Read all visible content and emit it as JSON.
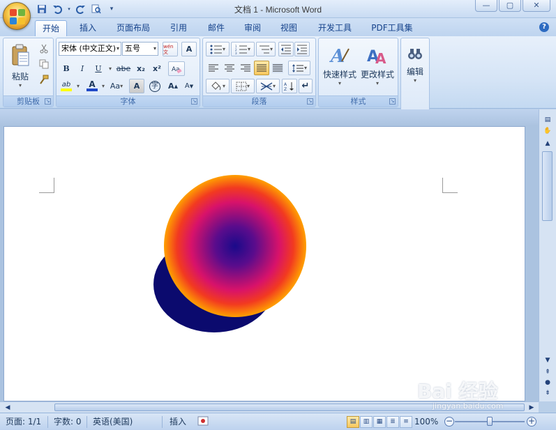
{
  "window": {
    "title": "文档 1 - Microsoft Word"
  },
  "quick_access": [
    "save-icon",
    "undo-icon",
    "redo-icon",
    "print-preview-icon",
    "customize-icon"
  ],
  "tabs": [
    {
      "label": "开始",
      "active": true
    },
    {
      "label": "插入"
    },
    {
      "label": "页面布局"
    },
    {
      "label": "引用"
    },
    {
      "label": "邮件"
    },
    {
      "label": "审阅"
    },
    {
      "label": "视图"
    },
    {
      "label": "开发工具"
    },
    {
      "label": "PDF工具集"
    }
  ],
  "ribbon": {
    "clipboard": {
      "label": "剪贴板",
      "paste_label": "粘贴"
    },
    "font": {
      "label": "字体",
      "font_name": "宋体 (中文正文)",
      "font_size": "五号",
      "bold": "B",
      "italic": "I",
      "underline": "U",
      "strike": "abe",
      "subscript": "x₂",
      "superscript": "x²",
      "highlight": "ab",
      "font_color": "A",
      "change_case": "Aa",
      "char_shade": "A",
      "enclose": "字",
      "grow": "A",
      "shrink": "A",
      "phonetic": "wén 文",
      "border": "A"
    },
    "paragraph": {
      "label": "段落"
    },
    "styles": {
      "label": "样式",
      "quick_styles": "快速样式",
      "change_styles": "更改样式"
    },
    "editing": {
      "label": "编辑"
    }
  },
  "statusbar": {
    "page": "页面: 1/1",
    "words": "字数: 0",
    "language": "英语(美国)",
    "mode": "插入",
    "zoom": "100%",
    "zoom_minus": "−",
    "zoom_plus": "+",
    "zoom_value": 1.0
  },
  "watermark": {
    "brand": "Bai 经验",
    "url": "jingyan.baidu.com"
  },
  "colors": {
    "ribbon_bg": "#d5e4f6",
    "shape_shadow": "#0b0a6e",
    "shape_center": "#1a0a8a",
    "shape_mid": "#d8126a",
    "shape_edge": "#ffa000"
  }
}
